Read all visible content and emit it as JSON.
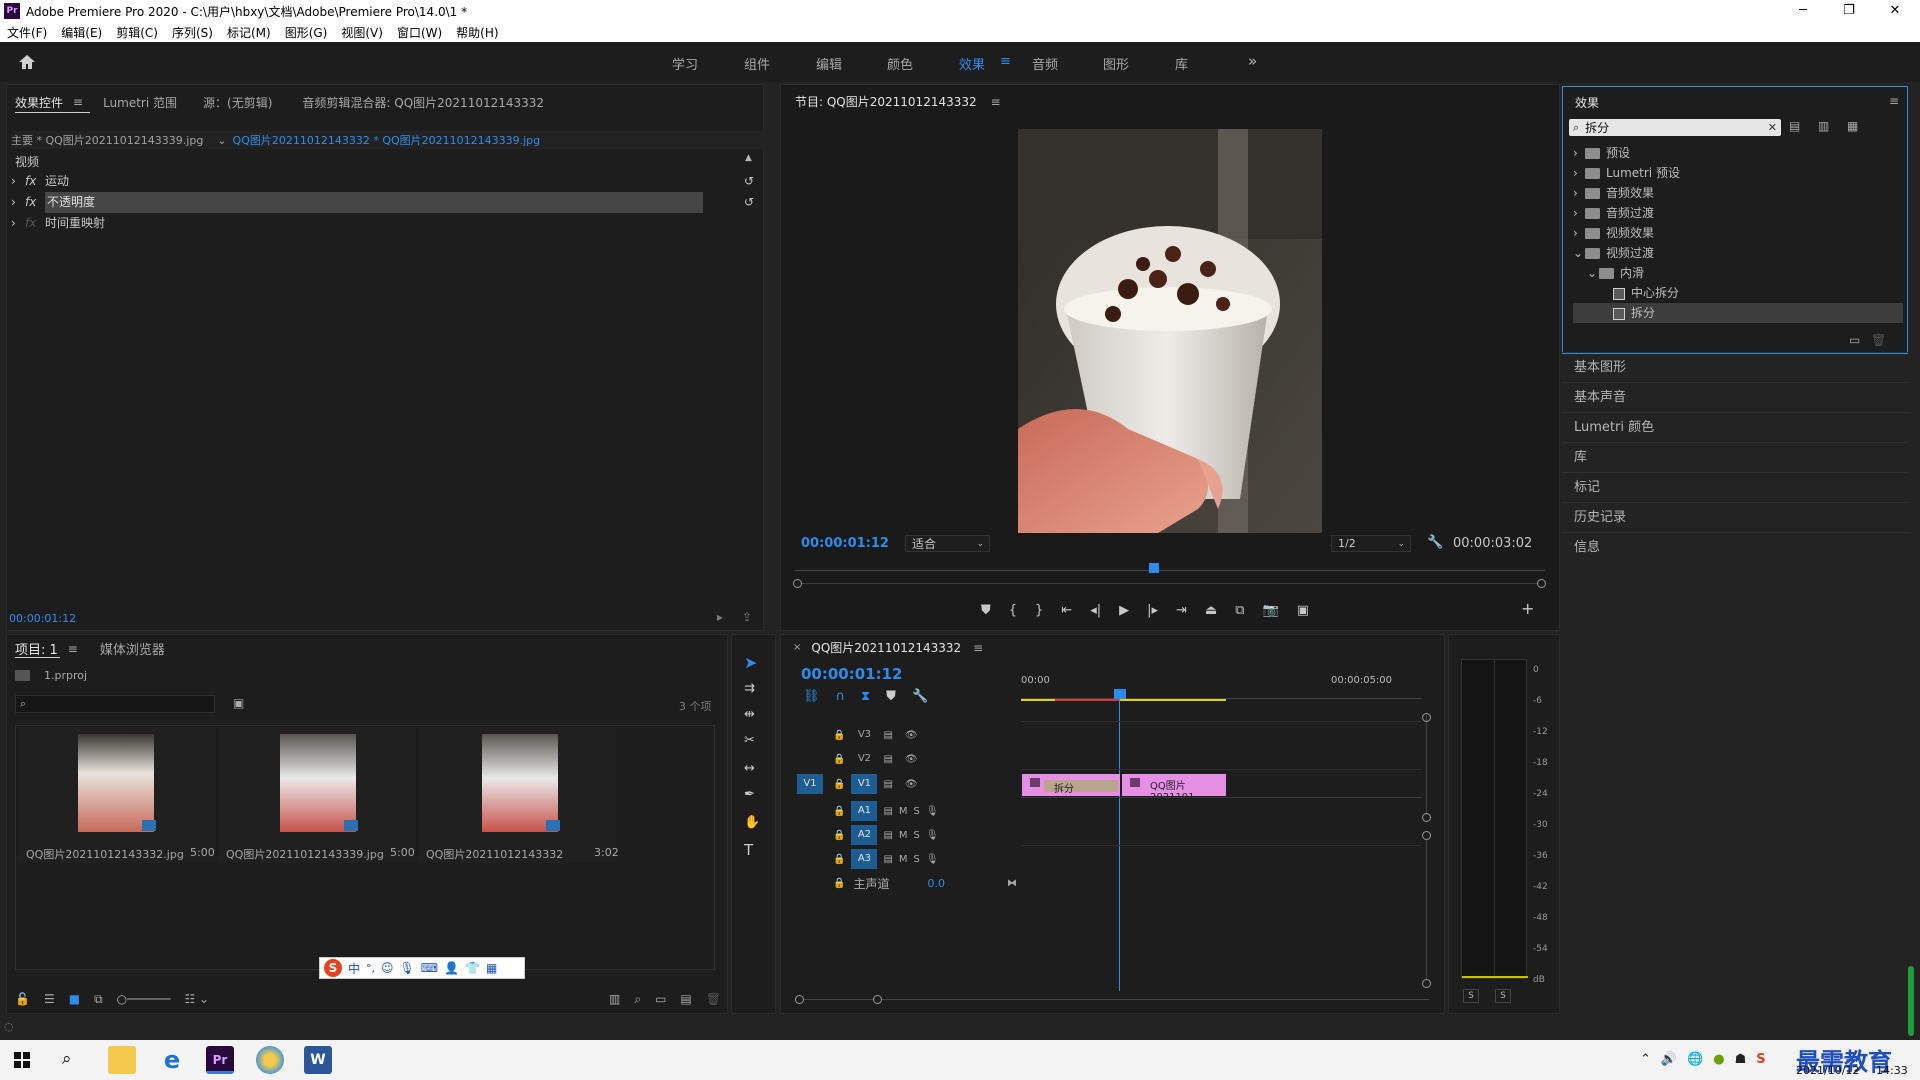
{
  "window": {
    "title": "Adobe Premiere Pro 2020 - C:\\用户\\hbxy\\文档\\Adobe\\Premiere Pro\\14.0\\1 *",
    "logo": "Pr"
  },
  "menu": [
    "文件(F)",
    "编辑(E)",
    "剪辑(C)",
    "序列(S)",
    "标记(M)",
    "图形(G)",
    "视图(V)",
    "窗口(W)",
    "帮助(H)"
  ],
  "workspaces": [
    "学习",
    "组件",
    "编辑",
    "颜色",
    "效果",
    "音频",
    "图形",
    "库"
  ],
  "active_workspace": "效果",
  "effect_controls": {
    "tabs": [
      "效果控件",
      "Lumetri 范围",
      "源：(无剪辑)",
      "音频剪辑混合器: QQ图片20211012143332"
    ],
    "master": "主要 * QQ图片20211012143339.jpg",
    "sequence_clip": "QQ图片20211012143332 * QQ图片20211012143339.jpg",
    "section": "视频",
    "rows": [
      "运动",
      "不透明度",
      "时间重映射"
    ],
    "fx": "fx",
    "timecode": "00:00:01:12"
  },
  "program": {
    "title": "节目: QQ图片20211012143332",
    "timecode": "00:00:01:12",
    "fit": "适合",
    "resolution": "1/2",
    "duration": "00:00:03:02"
  },
  "effects_panel": {
    "title": "效果",
    "search_value": "拆分",
    "tree": [
      "预设",
      "Lumetri 预设",
      "音频效果",
      "音频过渡",
      "视频效果",
      "视频过渡",
      "内滑",
      "中心拆分",
      "拆分"
    ]
  },
  "side_panels": [
    "基本图形",
    "基本声音",
    "Lumetri 颜色",
    "库",
    "标记",
    "历史记录",
    "信息"
  ],
  "project": {
    "tabs": [
      "项目: 1",
      "媒体浏览器"
    ],
    "file": "1.prproj",
    "count": "3 个项",
    "items": [
      {
        "name": "QQ图片20211012143332.jpg",
        "dur": "5:00"
      },
      {
        "name": "QQ图片20211012143339.jpg",
        "dur": "5:00"
      },
      {
        "name": "QQ图片20211012143332",
        "dur": "3:02"
      }
    ]
  },
  "timeline": {
    "title": "QQ图片20211012143332",
    "timecode": "00:00:01:12",
    "ruler": [
      "00:00",
      "00:00:05:00"
    ],
    "video_tracks": [
      "V3",
      "V2",
      "V1"
    ],
    "audio_tracks": [
      "A1",
      "A2",
      "A3"
    ],
    "source_patch": "V1",
    "m": "M",
    "s": "S",
    "master_label": "主声道",
    "master_value": "0.0",
    "clip1": "拆分",
    "clip2": "QQ图片2021101"
  },
  "meter": {
    "scale": [
      "0",
      "-6",
      "-12",
      "-18",
      "-24",
      "-30",
      "-36",
      "-42",
      "-48",
      "-54",
      "dB"
    ],
    "solo": "S"
  },
  "ime": {
    "mode": "中"
  },
  "taskbar": {
    "date": "2021/10/12",
    "time": "14:33",
    "watermark": "最需教育"
  },
  "colors": {
    "accent": "#2d8ceb",
    "clip_pink": "#e58fe5",
    "work_area": "#e0d400"
  }
}
